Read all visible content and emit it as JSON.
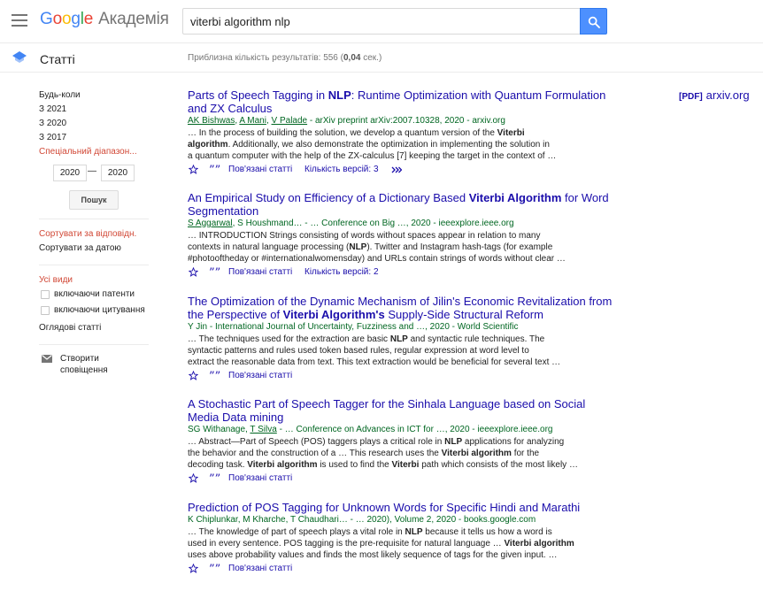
{
  "header": {
    "logo_google": [
      "G",
      "o",
      "o",
      "g",
      "l",
      "e"
    ],
    "logo_product": "Академія",
    "search_value": "viterbi algorithm nlp"
  },
  "subheader": {
    "title": "Статті",
    "results_prefix": "Приблизна кількість результатів: 556 (",
    "results_time": "0,04",
    "results_suffix": " сек.)"
  },
  "sidebar": {
    "time_filters": [
      "Будь-коли",
      "З 2021",
      "З 2020",
      "З 2017"
    ],
    "custom_range": "Спеціальний діапазон...",
    "date_from": "2020",
    "date_sep": "—",
    "date_to": "2020",
    "search_btn": "Пошук",
    "sort_relevance": "Сортувати за відповідн.",
    "sort_date": "Сортувати за датою",
    "all_types": "Усі види",
    "include_patents": "включаючи патенти",
    "include_citations": "включаючи цитування",
    "review_articles": "Оглядові статті",
    "create_alert": "Створити сповіщення"
  },
  "pdf": {
    "tag": "[PDF]",
    "site": "arxiv.org"
  },
  "actions": {
    "related": "Пов'язані статті",
    "versions_3": "Кількість версій: 3",
    "versions_2": "Кількість версій: 2"
  },
  "results": [
    {
      "title_a": "Parts of Speech Tagging in ",
      "title_b": "NLP",
      "title_c": ": Runtime Optimization with Quantum Formulation and ZX Calculus",
      "authors": [
        "AK Bishwas",
        "A Mani",
        "V Palade"
      ],
      "source": " - arXiv preprint arXiv:2007.10328, 2020 - arxiv.org",
      "s1a": "… In the process of building the solution, we develop a quantum version of the ",
      "s1b": "Viterbi",
      "s2a": "algorithm",
      "s2b": ". Additionally, we also demonstrate the optimization in implementing the solution in",
      "s3": "a quantum computer with the help of the ZX-calculus [7] keeping the target in the context of …"
    },
    {
      "title_a": "An Empirical Study on Efficiency of a Dictionary Based ",
      "title_b": "Viterbi Algorithm",
      "title_c": " for Word Segmentation",
      "authors": [
        "S Aggarwal"
      ],
      "authors_rest": ", S Houshmand… - … Conference on Big …, 2020 - ieeexplore.ieee.org",
      "s1": "… INTRODUCTION Strings consisting of words without spaces appear in relation to many",
      "s2a": "contexts in natural language processing (",
      "s2b": "NLP",
      "s2c": "). Twitter and Instagram hash-tags (for example",
      "s3": "#photooftheday or #internationalwomensday) and URLs contain strings of words without clear …"
    },
    {
      "title_a": "The Optimization of the Dynamic Mechanism of Jilin's Economic Revitalization from the Perspective of ",
      "title_b": "Viterbi Algorithm's",
      "title_c": " Supply-Side Structural Reform",
      "meta": "Y Jin - International Journal of Uncertainty, Fuzziness and …, 2020 - World Scientific",
      "s1a": "… The techniques used for the extraction are basic ",
      "s1b": "NLP",
      "s1c": " and syntactic rule techniques. The",
      "s2": "syntactic patterns and rules used token based rules, regular expression at word level to",
      "s3": "extract the reasonable data from text. This text extraction would be beneficial for several text …"
    },
    {
      "title_a": "A Stochastic Part of Speech Tagger for the Sinhala Language based on Social Media Data mining",
      "authors_a": "SG Withanage, ",
      "authors_b": "T Silva",
      "authors_rest": " - … Conference on Advances in ICT for …, 2020 - ieeexplore.ieee.org",
      "s1a": "… Abstract—Part of Speech (POS) taggers plays a critical role in ",
      "s1b": "NLP",
      "s1c": " applications for analyzing",
      "s2a": "the behavior and the construction of a … This research uses the ",
      "s2b": "Viterbi algorithm",
      "s2c": " for the",
      "s3a": "decoding task. ",
      "s3b": "Viterbi algorithm",
      "s3c": " is used to find the ",
      "s3d": "Viterbi",
      "s3e": " path which consists of the most likely …"
    },
    {
      "title_a": "Prediction of POS Tagging for Unknown Words for Specific Hindi and Marathi",
      "meta": "K Chiplunkar, M Kharche, T Chaudhari… - … 2020), Volume 2, 2020 - books.google.com",
      "s1a": "… The knowledge of part of speech plays a vital role in ",
      "s1b": "NLP",
      "s1c": " because it tells us how a word is",
      "s2a": "used in every sentence. POS tagging is the pre-requisite for natural language … ",
      "s2b": "Viterbi algorithm",
      "s3": "uses above probability values and finds the most likely sequence of tags for the given input. …"
    }
  ]
}
